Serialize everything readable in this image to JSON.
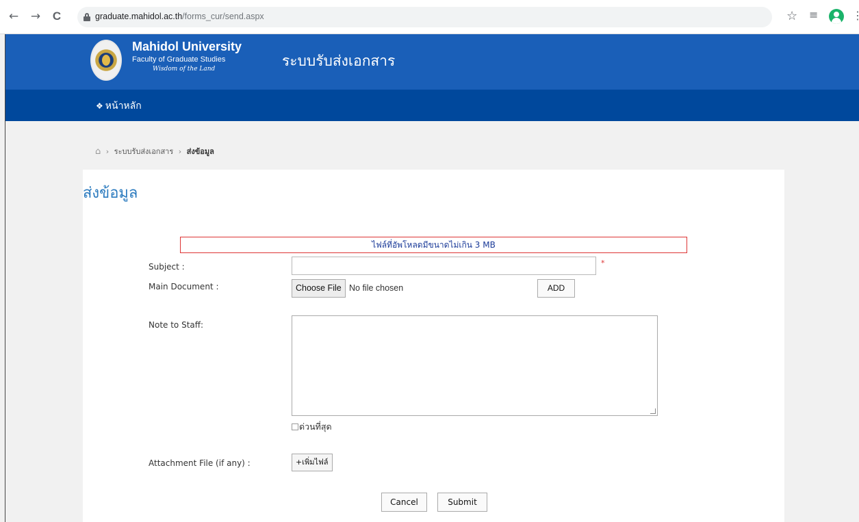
{
  "browser": {
    "url_host": "graduate.mahidol.ac.th",
    "url_path": "/forms_cur/send.aspx",
    "back_icon": "←",
    "forward_icon": "→",
    "reload_icon": "C",
    "star_icon": "☆",
    "queue_icon": "≡",
    "menu_icon": "⋮"
  },
  "header": {
    "university_name": "Mahidol University",
    "faculty_name": "Faculty of Graduate Studies",
    "motto": "Wisdom of the Land",
    "site_title": "ระบบรับส่งเอกสาร",
    "brand_color": "#1a5fb8"
  },
  "nav": {
    "home_icon": "❖",
    "home_label": "หน้าหลัก",
    "nav_color": "#00489c"
  },
  "breadcrumb": {
    "home_icon": "⌂",
    "separator": "›",
    "items": [
      "ระบบรับส่งเอกสาร",
      "ส่งข้อมูล"
    ]
  },
  "page": {
    "title": "ส่งข้อมูล",
    "notice": "ไฟล์ที่อัพโหลดมีขนาดไม่เกิน 3 MB"
  },
  "form": {
    "subject_label": "Subject :",
    "subject_value": "",
    "required_mark": "*",
    "main_document_label": "Main Document :",
    "choose_file_label": "Choose File",
    "file_status": "No file chosen",
    "add_label": "ADD",
    "note_label": "Note to Staff:",
    "note_value": "",
    "urgent_label": "ด่วนที่สุด",
    "urgent_checked": false,
    "attachment_label": "Attachment File (if any) :",
    "add_file_label": "+เพิ่มไฟล์",
    "cancel_label": "Cancel",
    "submit_label": "Submit"
  }
}
